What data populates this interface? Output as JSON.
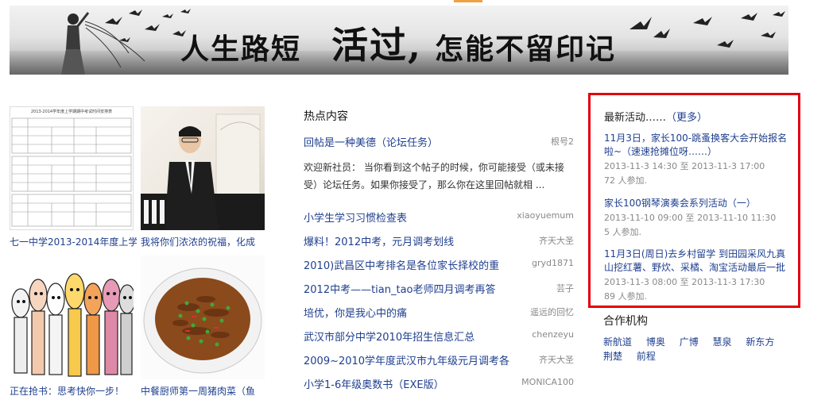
{
  "banner": {
    "part1": "人生路短",
    "part2": "活过,",
    "part3": "怎能不留印记"
  },
  "thumbs": [
    {
      "caption": "七一中学2013-2014年度上学",
      "table_title": "2013-2014学年度上学期期中考试时间安排表"
    },
    {
      "caption": "我将你们浓浓的祝福，化成"
    },
    {
      "caption": "正在抢书：思考快你一步！"
    },
    {
      "caption": "中餐厨师第一周猪肉菜（鱼"
    }
  ],
  "hot": {
    "title": "热点内容",
    "items": [
      {
        "title": "回帖是一种美德（论坛任务）",
        "user": "根号2"
      },
      {
        "title": "小学生学习习惯检查表",
        "user": "xiaoyuemum"
      },
      {
        "title": "爆料！2012中考，元月调考划线",
        "user": "齐天大圣"
      },
      {
        "title": "2010)武昌区中考排名是各位家长择校的重",
        "user": "gryd1871"
      },
      {
        "title": "2012中考——tian_tao老师四月调考再答",
        "user": "芸子"
      },
      {
        "title": "培优，你是我心中的痛",
        "user": "遥远的回忆"
      },
      {
        "title": "武汉市部分中学2010年招生信息汇总",
        "user": "chenzeyu"
      },
      {
        "title": "2009~2010学年度武汉市九年级元月调考各",
        "user": "齐天大圣"
      },
      {
        "title": "小学1-6年级奥数书（EXE版）",
        "user": "MONICA100"
      }
    ],
    "desc": "欢迎新社员： 当你看到这个帖子的时候，你可能接受（或未接受）论坛任务。如果你接受了，那么你在这里回帖就相 ..."
  },
  "activity": {
    "title": "最新活动……",
    "more": "（更多）",
    "items": [
      {
        "name": "11月3日，家长100-跳蚤换客大会开始报名啦~（速速抢摊位呀……）",
        "start": "2013-11-3 14:30",
        "sep": "至",
        "end": "2013-11-3 17:00",
        "count": "72 人参加."
      },
      {
        "name": "家长100钢琴演奏会系列活动（一）",
        "start": "2013-11-10 09:00",
        "sep": "至",
        "end": "2013-11-10 11:30",
        "count": "5 人参加."
      },
      {
        "name": "11月3日(周日)去乡村留学 到田园采风九真山挖红薯、野炊、采橘、淘宝活动最后一批",
        "start": "2013-11-3 08:00",
        "sep": "至",
        "end": "2013-11-3 17:30",
        "count": "89 人参加."
      }
    ]
  },
  "partner": {
    "title": "合作机构",
    "links": [
      "新航道",
      "博奥",
      "广博",
      "慧泉",
      "新东方",
      "荆楚",
      "前程"
    ]
  },
  "colors": {
    "link": "#1f3f8f",
    "highlight_border": "#e2000f",
    "accent_tab": "#f0a040"
  }
}
